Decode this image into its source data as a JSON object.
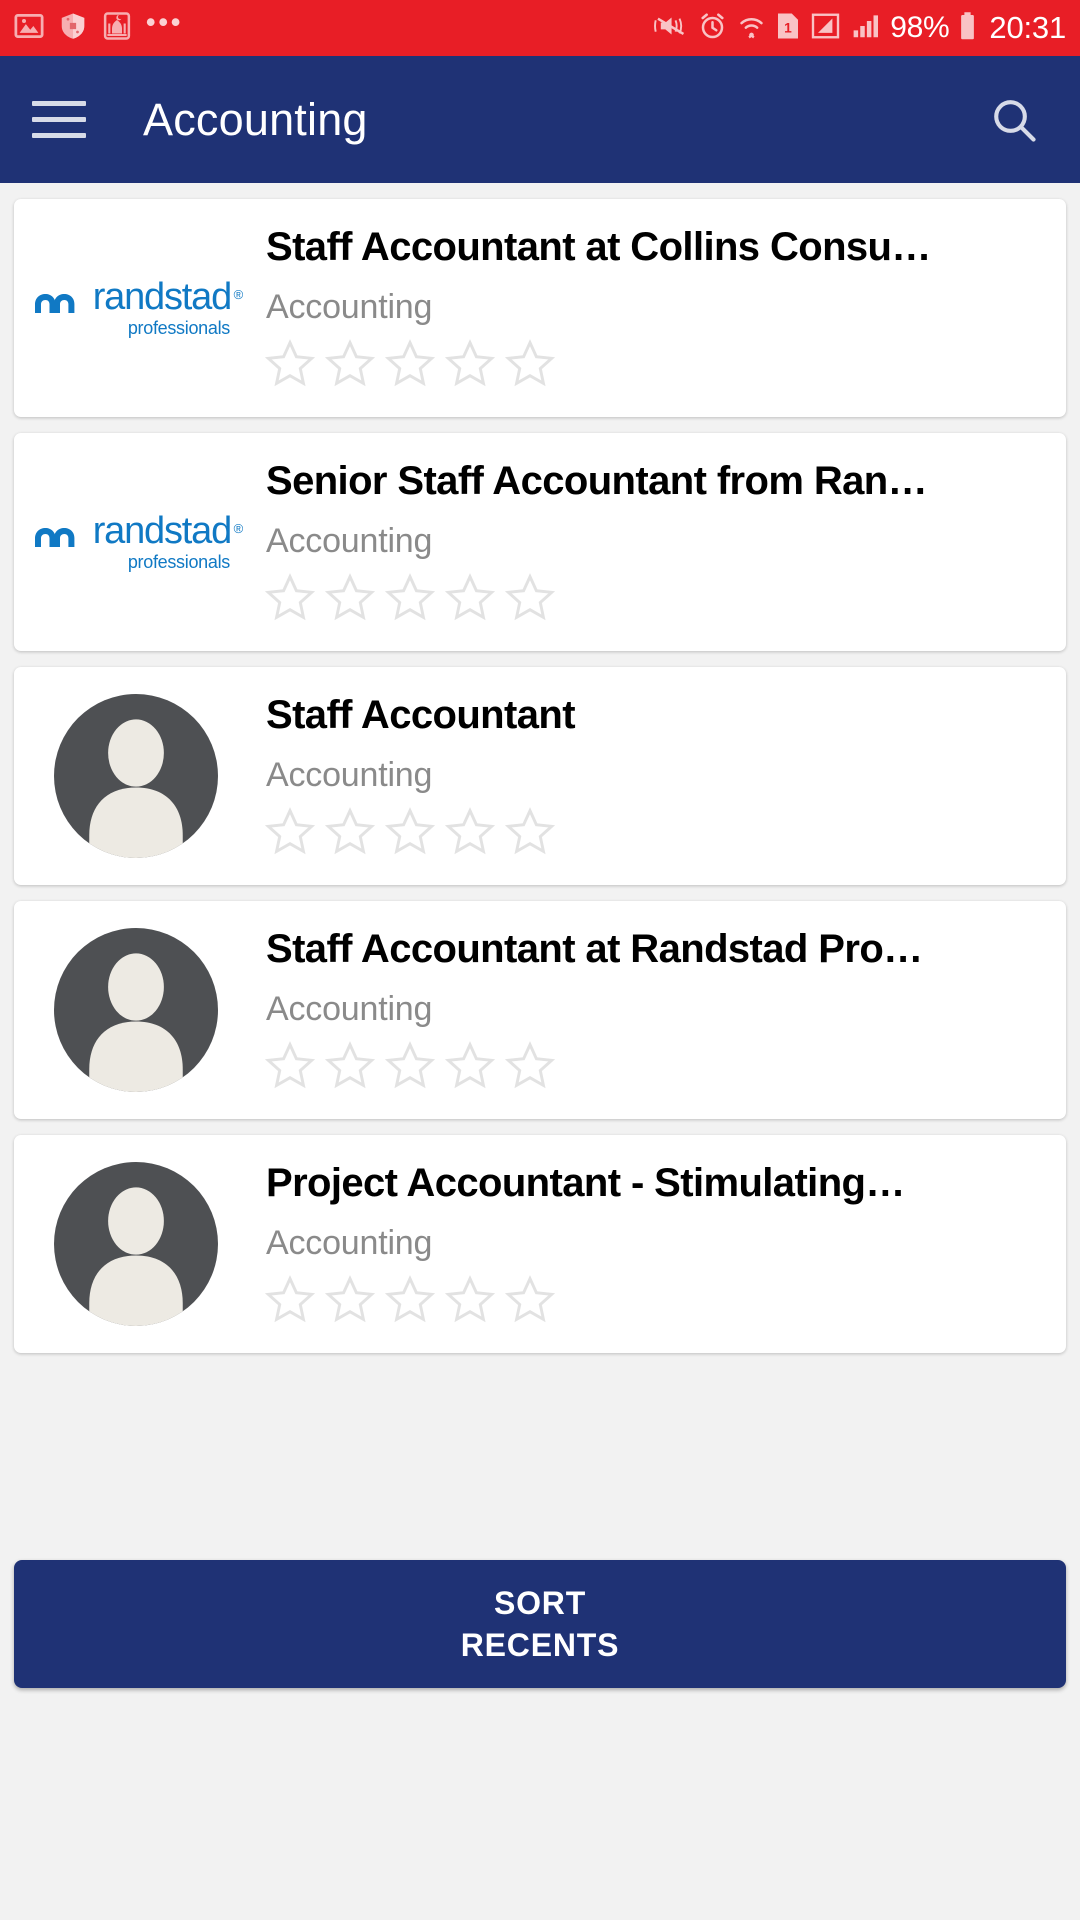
{
  "status_bar": {
    "background": "#e81e26",
    "left_icons": [
      "image-icon",
      "shield-icon",
      "mosque-icon"
    ],
    "overflow": "•••",
    "right_icons": [
      "vibrate-mute-icon",
      "alarm-icon",
      "wifi-icon",
      "sim1-icon",
      "signal-outline-icon",
      "signal-bars-icon",
      "battery-icon"
    ],
    "battery_percent": "98%",
    "clock": "20:31"
  },
  "app_bar": {
    "background": "#1f3275",
    "menu_icon": "hamburger-icon",
    "title": "Accounting",
    "search_icon": "search-icon"
  },
  "cards": [
    {
      "title": "Staff Accountant at Collins Consu…",
      "subtitle": "Accounting",
      "media": "randstad-logo",
      "logo_word": "randstad",
      "logo_sub": "professionals",
      "rating": 0,
      "max_rating": 5
    },
    {
      "title": "Senior Staff Accountant from Ran…",
      "subtitle": "Accounting",
      "media": "randstad-logo",
      "logo_word": "randstad",
      "logo_sub": "professionals",
      "rating": 0,
      "max_rating": 5
    },
    {
      "title": "Staff Accountant",
      "subtitle": "Accounting",
      "media": "avatar-placeholder",
      "rating": 0,
      "max_rating": 5
    },
    {
      "title": "Staff Accountant at Randstad Pro…",
      "subtitle": "Accounting",
      "media": "avatar-placeholder",
      "rating": 0,
      "max_rating": 5
    },
    {
      "title": "Project Accountant - Stimulating…",
      "subtitle": "Accounting",
      "media": "avatar-placeholder",
      "rating": 0,
      "max_rating": 5
    }
  ],
  "bottom_button": {
    "line1": "SORT",
    "line2": "RECENTS",
    "background": "#1f3275"
  }
}
